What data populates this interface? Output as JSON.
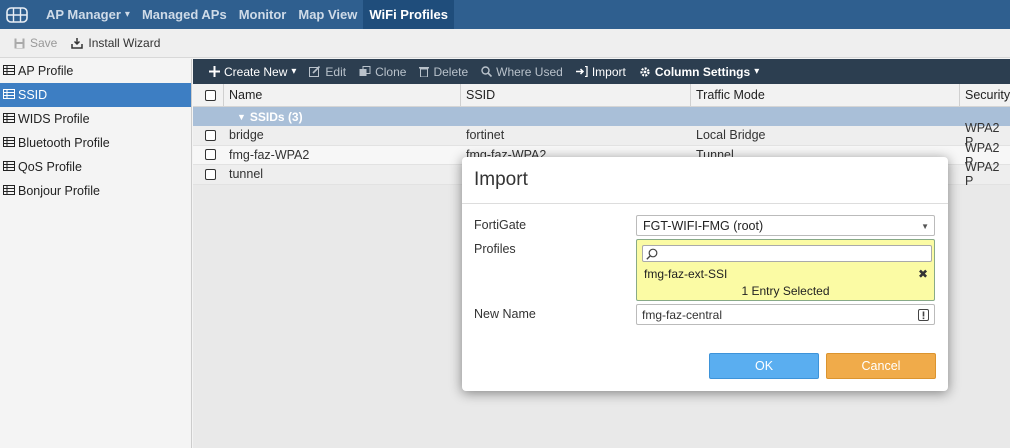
{
  "topnav": {
    "items": [
      {
        "label": "AP Manager",
        "has_caret": true
      },
      {
        "label": "Managed APs"
      },
      {
        "label": "Monitor"
      },
      {
        "label": "Map View"
      },
      {
        "label": "WiFi Profiles",
        "active": true
      }
    ]
  },
  "toolbar": {
    "save_label": "Save",
    "install_label": "Install Wizard"
  },
  "sidebar": {
    "items": [
      {
        "label": "AP Profile"
      },
      {
        "label": "SSID",
        "active": true
      },
      {
        "label": "WIDS Profile"
      },
      {
        "label": "Bluetooth Profile"
      },
      {
        "label": "QoS Profile"
      },
      {
        "label": "Bonjour Profile"
      }
    ]
  },
  "actions": {
    "create_new": "Create New",
    "edit": "Edit",
    "clone": "Clone",
    "delete": "Delete",
    "where_used": "Where Used",
    "import": "Import",
    "column_settings": "Column Settings"
  },
  "table": {
    "headers": [
      "Name",
      "SSID",
      "Traffic Mode",
      "Security"
    ],
    "group_label": "SSIDs (3)",
    "rows": [
      {
        "name": "bridge",
        "ssid": "fortinet",
        "mode": "Local Bridge",
        "security": "WPA2 P"
      },
      {
        "name": "fmg-faz-WPA2",
        "ssid": "fmg-faz-WPA2",
        "mode": "Tunnel",
        "security": "WPA2 P"
      },
      {
        "name": "tunnel",
        "ssid": "",
        "mode": "",
        "security": "WPA2 P"
      }
    ]
  },
  "modal": {
    "title": "Import",
    "fortigate_label": "FortiGate",
    "fortigate_value": "FGT-WIFI-FMG (root)",
    "profiles_label": "Profiles",
    "profiles_selected": "fmg-faz-ext-SSI",
    "profiles_count": "1 Entry Selected",
    "new_name_label": "New Name",
    "new_name_value": "fmg-faz-central",
    "ok_label": "OK",
    "cancel_label": "Cancel"
  },
  "colors": {
    "nav_bg": "#2f5f8f",
    "sidebar_active": "#3d7ec3",
    "action_bar": "#2c3e50",
    "ok_button": "#5aaef0",
    "cancel_button": "#f0ab4a",
    "selection_highlight": "#fbfba4"
  }
}
